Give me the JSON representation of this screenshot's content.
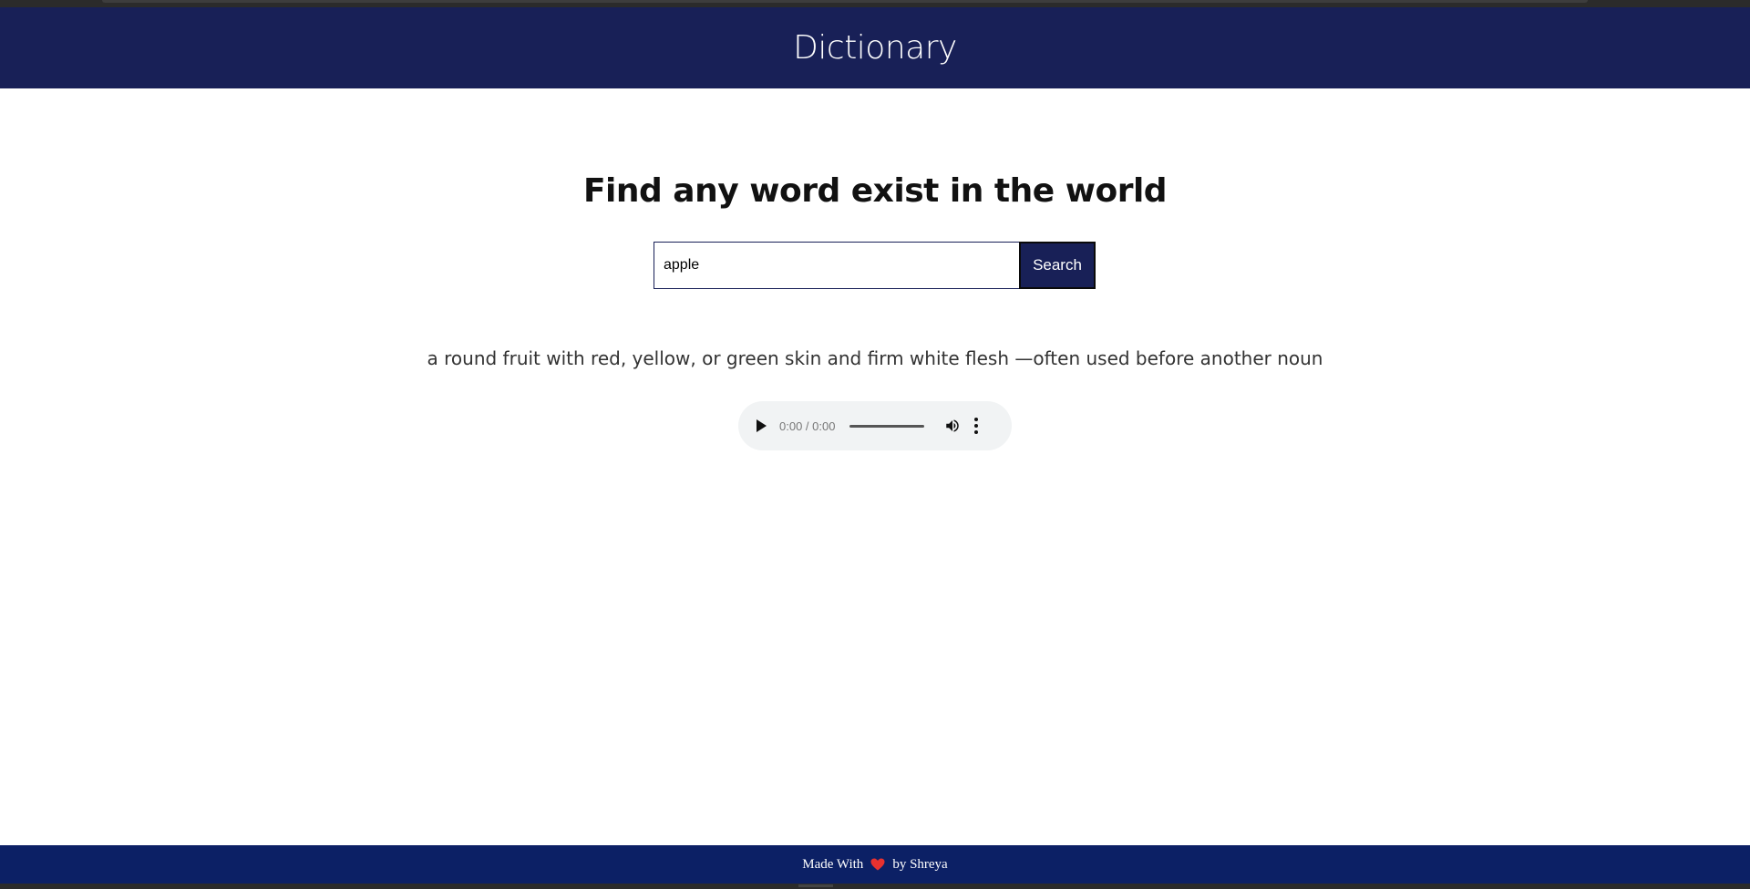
{
  "header": {
    "title": "Dictionary"
  },
  "main": {
    "heading": "Find any word exist in the world",
    "search": {
      "value": "apple",
      "button_label": "Search"
    },
    "definition": "a round fruit with red, yellow, or green skin and firm white flesh —often used before another noun",
    "audio": {
      "time": "0:00 / 0:00",
      "progress_fraction": 0.0
    }
  },
  "footer": {
    "made_with": "Made With",
    "by_text": "by Shreya"
  },
  "colors": {
    "header_bg": "#182057",
    "footer_bg": "#0c2065",
    "heart": "#e8312f"
  }
}
